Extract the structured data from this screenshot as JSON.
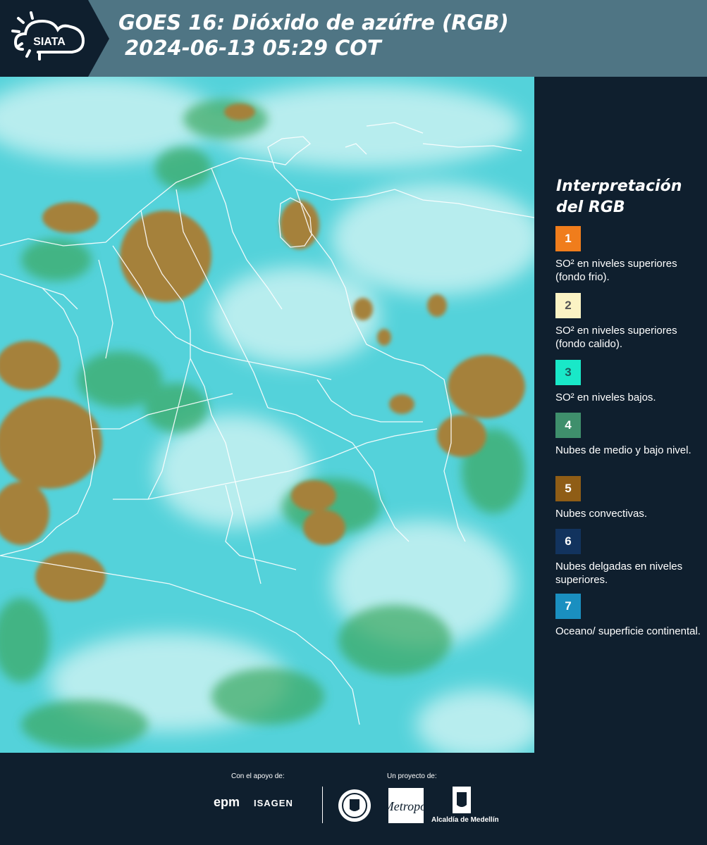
{
  "header": {
    "logo_text": "SIATA",
    "title_line1": "GOES 16: Dióxido de azúfre (RGB)",
    "title_line2": "2024-06-13 05:29 COT"
  },
  "legend": {
    "title": "Interpretación del RGB",
    "items": [
      {
        "number": "1",
        "color": "#f07d1c",
        "text_color": "#ffffff",
        "label": "SO² en niveles superiores (fondo frio)."
      },
      {
        "number": "2",
        "color": "#fbf3c4",
        "text_color": "#555555",
        "label": "SO² en niveles superiores (fondo calido)."
      },
      {
        "number": "3",
        "color": "#19e8c8",
        "text_color": "#1a5b5b",
        "label": "SO² en niveles bajos."
      },
      {
        "number": "4",
        "color": "#3f8f6c",
        "text_color": "#ffffff",
        "label": "Nubes de medio y bajo nivel."
      },
      {
        "number": "5",
        "color": "#8f5d16",
        "text_color": "#ffffff",
        "label": "Nubes convectivas."
      },
      {
        "number": "6",
        "color": "#12335e",
        "text_color": "#ffffff",
        "label": "Nubes delgadas en niveles superiores."
      },
      {
        "number": "7",
        "color": "#1a8fc0",
        "text_color": "#ffffff",
        "label": "Oceano/ superficie continental."
      }
    ]
  },
  "footer": {
    "support_label": "Con el apoyo de:",
    "project_label": "Un proyecto de:",
    "sponsor_1": "epm",
    "sponsor_2": "ISAGEN",
    "partner_metro": "Área Metropolitana",
    "partner_alcaldia": "Alcaldía de Medellín"
  }
}
